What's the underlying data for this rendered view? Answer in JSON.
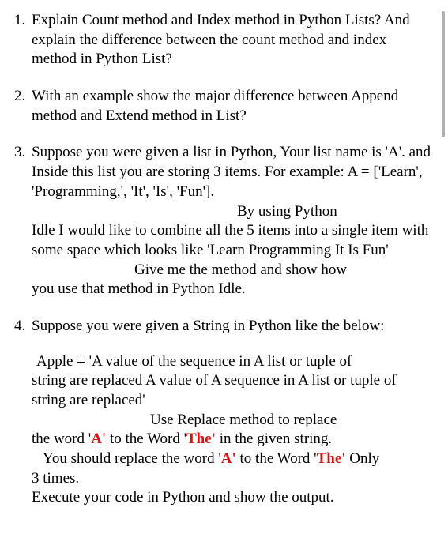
{
  "questions": {
    "q1": {
      "text": "Explain Count method and Index method in Python Lists? And explain the difference between the count method and index method in Python List?"
    },
    "q2": {
      "text": "With an example show the major difference between Append method and Extend method in List?"
    },
    "q3": {
      "p1": "Suppose you were given a list in Python, Your list name is 'A'. and Inside this list you are storing 3 items. For example: A = ['Learn', 'Programming,', 'It', 'Is', 'Fun'].",
      "p2": "By using Python",
      "p3": "Idle I would like to combine all the 5 items into a single item with some space which looks like 'Learn Programming It Is Fun'",
      "p4": "Give me the method and show how",
      "p5": "you use that method in Python Idle."
    },
    "q4": {
      "p1": "Suppose you were given a String in Python like the below:",
      "p2": "Apple = 'A value of the sequence in A list or tuple of",
      "p3": "string are replaced A value of A sequence in A list or tuple of string are replaced'",
      "p4": "Use Replace method to replace",
      "p5a": "the word '",
      "p5b": "A'",
      "p5c": " to the Word '",
      "p5d": "The'",
      "p5e": " in the given string.",
      "p6a": "You should replace the word '",
      "p6b": "A'",
      "p6c": " to the Word '",
      "p6d": "The'",
      "p6e": " Only",
      "p7": "3 times.",
      "p8": "Execute your code in Python and show the output."
    }
  }
}
